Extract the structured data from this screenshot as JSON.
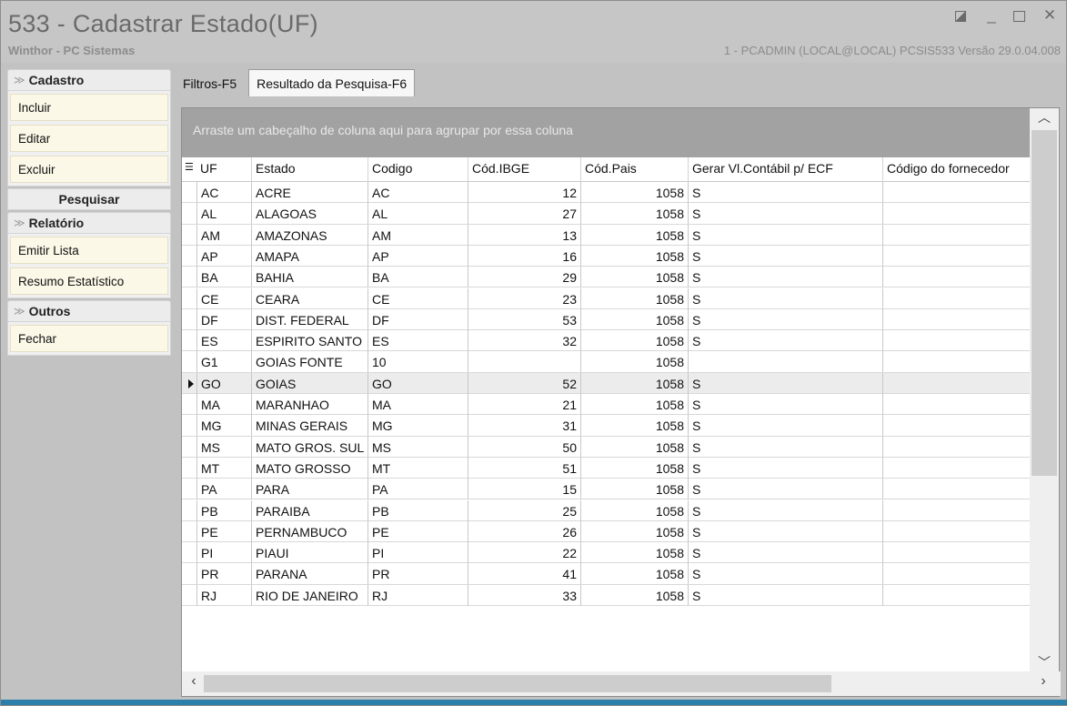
{
  "window": {
    "title": "533 - Cadastrar Estado(UF)",
    "company": "Winthor - PC Sistemas",
    "status_info": "1 - PCADMIN (LOCAL@LOCAL)   PCSIS533  Versão  29.0.04.008"
  },
  "sidebar": {
    "cadastro": {
      "title": "Cadastro",
      "items": [
        "Incluir",
        "Editar",
        "Excluir"
      ]
    },
    "pesquisar": {
      "title": "Pesquisar"
    },
    "relatorio": {
      "title": "Relatório",
      "items": [
        "Emitir Lista",
        "Resumo Estatístico"
      ]
    },
    "outros": {
      "title": "Outros",
      "items": [
        "Fechar"
      ]
    }
  },
  "tabs": [
    {
      "label": "Filtros-F5",
      "active": false
    },
    {
      "label": "Resultado da Pesquisa-F6",
      "active": true
    }
  ],
  "grid": {
    "group_hint": "Arraste um cabeçalho de coluna aqui para agrupar por essa coluna",
    "columns": [
      "UF",
      "Estado",
      "Codigo",
      "Cód.IBGE",
      "Cód.Pais",
      "Gerar Vl.Contábil p/ ECF",
      "Código do fornecedor"
    ],
    "rows": [
      {
        "uf": "AC",
        "estado": "ACRE",
        "codigo": "AC",
        "ibge": "12",
        "pais": "1058",
        "ecf": "S",
        "forn": ""
      },
      {
        "uf": "AL",
        "estado": "ALAGOAS",
        "codigo": "AL",
        "ibge": "27",
        "pais": "1058",
        "ecf": "S",
        "forn": ""
      },
      {
        "uf": "AM",
        "estado": "AMAZONAS",
        "codigo": "AM",
        "ibge": "13",
        "pais": "1058",
        "ecf": "S",
        "forn": ""
      },
      {
        "uf": "AP",
        "estado": "AMAPA",
        "codigo": "AP",
        "ibge": "16",
        "pais": "1058",
        "ecf": "S",
        "forn": ""
      },
      {
        "uf": "BA",
        "estado": "BAHIA",
        "codigo": "BA",
        "ibge": "29",
        "pais": "1058",
        "ecf": "S",
        "forn": ""
      },
      {
        "uf": "CE",
        "estado": "CEARA",
        "codigo": "CE",
        "ibge": "23",
        "pais": "1058",
        "ecf": "S",
        "forn": ""
      },
      {
        "uf": "DF",
        "estado": "DIST. FEDERAL",
        "codigo": "DF",
        "ibge": "53",
        "pais": "1058",
        "ecf": "S",
        "forn": ""
      },
      {
        "uf": "ES",
        "estado": "ESPIRITO SANTO",
        "codigo": "ES",
        "ibge": "32",
        "pais": "1058",
        "ecf": "S",
        "forn": ""
      },
      {
        "uf": "G1",
        "estado": "GOIAS FONTE",
        "codigo": "10",
        "ibge": "",
        "pais": "1058",
        "ecf": "",
        "forn": ""
      },
      {
        "uf": "GO",
        "estado": "GOIAS",
        "codigo": "GO",
        "ibge": "52",
        "pais": "1058",
        "ecf": "S",
        "forn": "",
        "selected": true
      },
      {
        "uf": "MA",
        "estado": "MARANHAO",
        "codigo": "MA",
        "ibge": "21",
        "pais": "1058",
        "ecf": "S",
        "forn": ""
      },
      {
        "uf": "MG",
        "estado": "MINAS GERAIS",
        "codigo": "MG",
        "ibge": "31",
        "pais": "1058",
        "ecf": "S",
        "forn": ""
      },
      {
        "uf": "MS",
        "estado": "MATO GROS. SUL",
        "codigo": "MS",
        "ibge": "50",
        "pais": "1058",
        "ecf": "S",
        "forn": ""
      },
      {
        "uf": "MT",
        "estado": "MATO GROSSO",
        "codigo": "MT",
        "ibge": "51",
        "pais": "1058",
        "ecf": "S",
        "forn": ""
      },
      {
        "uf": "PA",
        "estado": "PARA",
        "codigo": "PA",
        "ibge": "15",
        "pais": "1058",
        "ecf": "S",
        "forn": ""
      },
      {
        "uf": "PB",
        "estado": "PARAIBA",
        "codigo": "PB",
        "ibge": "25",
        "pais": "1058",
        "ecf": "S",
        "forn": ""
      },
      {
        "uf": "PE",
        "estado": "PERNAMBUCO",
        "codigo": "PE",
        "ibge": "26",
        "pais": "1058",
        "ecf": "S",
        "forn": ""
      },
      {
        "uf": "PI",
        "estado": "PIAUI",
        "codigo": "PI",
        "ibge": "22",
        "pais": "1058",
        "ecf": "S",
        "forn": ""
      },
      {
        "uf": "PR",
        "estado": "PARANA",
        "codigo": "PR",
        "ibge": "41",
        "pais": "1058",
        "ecf": "S",
        "forn": ""
      },
      {
        "uf": "RJ",
        "estado": "RIO DE JANEIRO",
        "codigo": "RJ",
        "ibge": "33",
        "pais": "1058",
        "ecf": "S",
        "forn": ""
      }
    ]
  },
  "colors": {
    "accent_bottom": "#2b7fa9",
    "sidebar_button": "#fbf8e8",
    "group_area": "#a2a2a2"
  },
  "icons": [
    "restore-icon",
    "minimize-icon",
    "maximize-icon",
    "close-icon",
    "chevron-up-icon",
    "chevron-down-icon",
    "scroll-left-icon",
    "scroll-right-icon",
    "column-chooser-icon",
    "row-indicator-icon"
  ]
}
